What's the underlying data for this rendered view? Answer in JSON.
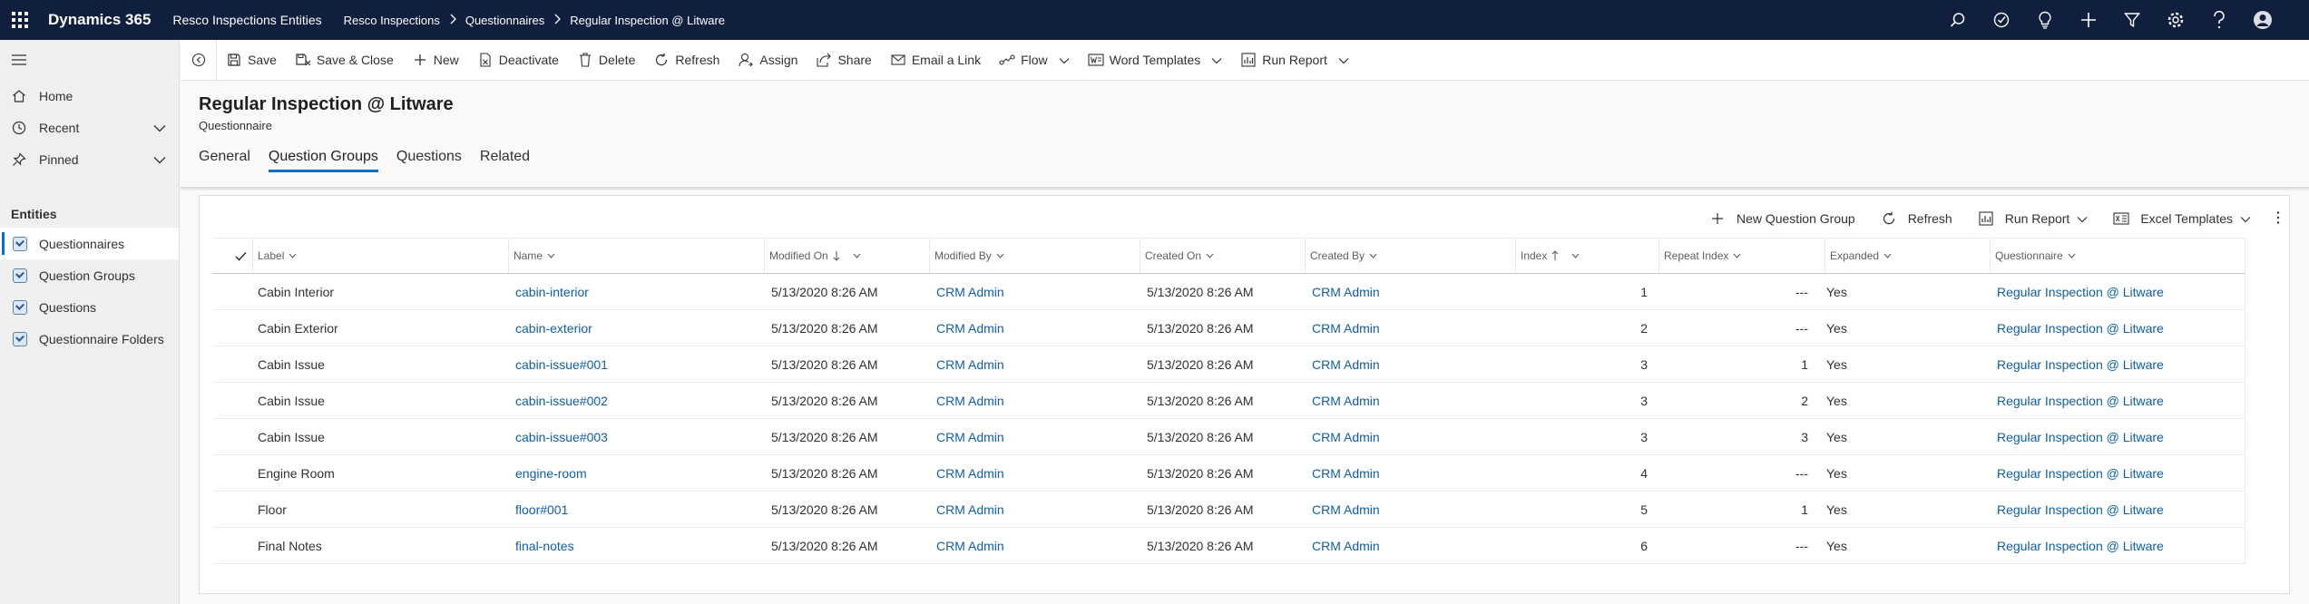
{
  "topbar": {
    "app_name": "Dynamics 365",
    "app_area": "Resco Inspections Entities",
    "breadcrumbs": [
      "Resco Inspections",
      "Questionnaires",
      "Regular Inspection @ Litware"
    ],
    "icons": [
      "search-icon",
      "task-flow-icon",
      "lightbulb-icon",
      "plus-icon",
      "filter-icon",
      "settings-icon",
      "help-icon",
      "user-icon"
    ]
  },
  "sidebar": {
    "nav": [
      {
        "label": "Home",
        "icon": "home-icon"
      },
      {
        "label": "Recent",
        "icon": "clock-icon"
      },
      {
        "label": "Pinned",
        "icon": "pin-icon"
      }
    ],
    "section_title": "Entities",
    "entities": [
      {
        "label": "Questionnaires",
        "active": true
      },
      {
        "label": "Question Groups",
        "active": false
      },
      {
        "label": "Questions",
        "active": false
      },
      {
        "label": "Questionnaire Folders",
        "active": false
      }
    ]
  },
  "commandbar": {
    "save": "Save",
    "save_close": "Save & Close",
    "new": "New",
    "deactivate": "Deactivate",
    "delete": "Delete",
    "refresh": "Refresh",
    "assign": "Assign",
    "share": "Share",
    "email_link": "Email a Link",
    "flow": "Flow",
    "word_templates": "Word Templates",
    "run_report": "Run Report"
  },
  "record": {
    "title": "Regular Inspection @ Litware",
    "entity": "Questionnaire"
  },
  "tabs": [
    "General",
    "Question Groups",
    "Questions",
    "Related"
  ],
  "active_tab": "Question Groups",
  "subgrid": {
    "commands": {
      "new_group": "New Question Group",
      "refresh": "Refresh",
      "run_report": "Run Report",
      "excel_templates": "Excel Templates"
    },
    "columns": {
      "label": "Label",
      "name": "Name",
      "modified_on": "Modified On",
      "modified_by": "Modified By",
      "created_on": "Created On",
      "created_by": "Created By",
      "index": "Index",
      "repeat_index": "Repeat Index",
      "expanded": "Expanded",
      "questionnaire": "Questionnaire"
    },
    "rows": [
      {
        "label": "Cabin Interior",
        "name": "cabin-interior",
        "modified_on": "5/13/2020 8:26 AM",
        "modified_by": "CRM Admin",
        "created_on": "5/13/2020 8:26 AM",
        "created_by": "CRM Admin",
        "index": "1",
        "repeat_index": "---",
        "expanded": "Yes",
        "questionnaire": "Regular Inspection @ Litware"
      },
      {
        "label": "Cabin Exterior",
        "name": "cabin-exterior",
        "modified_on": "5/13/2020 8:26 AM",
        "modified_by": "CRM Admin",
        "created_on": "5/13/2020 8:26 AM",
        "created_by": "CRM Admin",
        "index": "2",
        "repeat_index": "---",
        "expanded": "Yes",
        "questionnaire": "Regular Inspection @ Litware"
      },
      {
        "label": "Cabin Issue",
        "name": "cabin-issue#001",
        "modified_on": "5/13/2020 8:26 AM",
        "modified_by": "CRM Admin",
        "created_on": "5/13/2020 8:26 AM",
        "created_by": "CRM Admin",
        "index": "3",
        "repeat_index": "1",
        "expanded": "Yes",
        "questionnaire": "Regular Inspection @ Litware"
      },
      {
        "label": "Cabin Issue",
        "name": "cabin-issue#002",
        "modified_on": "5/13/2020 8:26 AM",
        "modified_by": "CRM Admin",
        "created_on": "5/13/2020 8:26 AM",
        "created_by": "CRM Admin",
        "index": "3",
        "repeat_index": "2",
        "expanded": "Yes",
        "questionnaire": "Regular Inspection @ Litware"
      },
      {
        "label": "Cabin Issue",
        "name": "cabin-issue#003",
        "modified_on": "5/13/2020 8:26 AM",
        "modified_by": "CRM Admin",
        "created_on": "5/13/2020 8:26 AM",
        "created_by": "CRM Admin",
        "index": "3",
        "repeat_index": "3",
        "expanded": "Yes",
        "questionnaire": "Regular Inspection @ Litware"
      },
      {
        "label": "Engine Room",
        "name": "engine-room",
        "modified_on": "5/13/2020 8:26 AM",
        "modified_by": "CRM Admin",
        "created_on": "5/13/2020 8:26 AM",
        "created_by": "CRM Admin",
        "index": "4",
        "repeat_index": "---",
        "expanded": "Yes",
        "questionnaire": "Regular Inspection @ Litware"
      },
      {
        "label": "Floor",
        "name": "floor#001",
        "modified_on": "5/13/2020 8:26 AM",
        "modified_by": "CRM Admin",
        "created_on": "5/13/2020 8:26 AM",
        "created_by": "CRM Admin",
        "index": "5",
        "repeat_index": "1",
        "expanded": "Yes",
        "questionnaire": "Regular Inspection @ Litware"
      },
      {
        "label": "Final Notes",
        "name": "final-notes",
        "modified_on": "5/13/2020 8:26 AM",
        "modified_by": "CRM Admin",
        "created_on": "5/13/2020 8:26 AM",
        "created_by": "CRM Admin",
        "index": "6",
        "repeat_index": "---",
        "expanded": "Yes",
        "questionnaire": "Regular Inspection @ Litware"
      }
    ]
  },
  "colors": {
    "topbar_bg": "#0f1f3d",
    "accent": "#0f6cbd",
    "link": "#115ea3"
  }
}
